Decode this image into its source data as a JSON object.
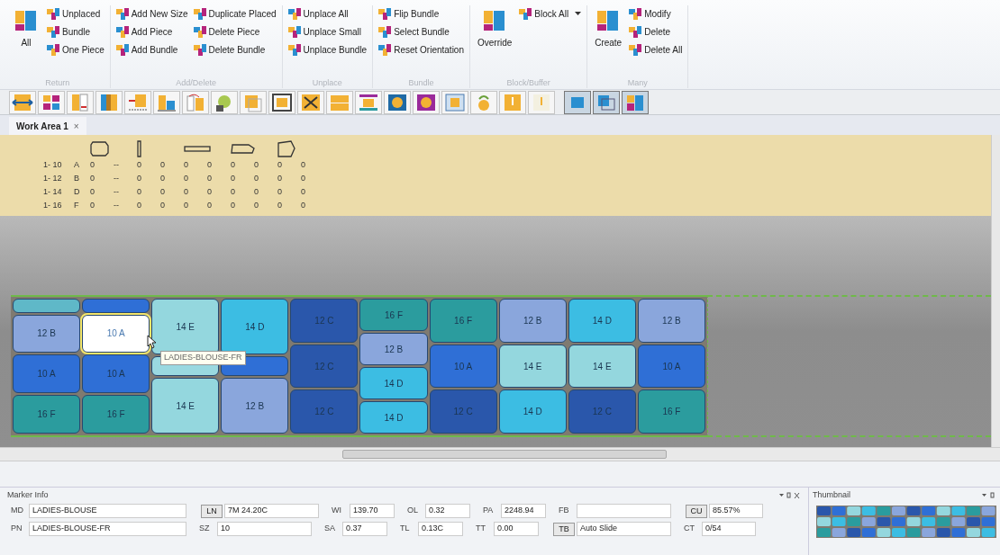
{
  "ribbon": {
    "groups": [
      {
        "title": "Return",
        "large": [
          {
            "label": "All"
          }
        ],
        "small": [
          {
            "label": "Unplaced"
          },
          {
            "label": "Bundle"
          },
          {
            "label": "One Piece"
          }
        ]
      },
      {
        "title": "Add/Delete",
        "small": [
          {
            "label": "Add New Size"
          },
          {
            "label": "Add Piece"
          },
          {
            "label": "Add Bundle"
          },
          {
            "label": "Duplicate Placed"
          },
          {
            "label": "Delete Piece"
          },
          {
            "label": "Delete Bundle"
          }
        ]
      },
      {
        "title": "Unplace",
        "small": [
          {
            "label": "Unplace All"
          },
          {
            "label": "Unplace Small"
          },
          {
            "label": "Unplace Bundle"
          }
        ]
      },
      {
        "title": "Bundle",
        "small": [
          {
            "label": "Flip Bundle"
          },
          {
            "label": "Select Bundle"
          },
          {
            "label": "Reset Orientation"
          }
        ]
      },
      {
        "title": "Block/Buffer",
        "large": [
          {
            "label": "Override"
          }
        ],
        "small": [
          {
            "label": "Block All",
            "dropdown": true
          }
        ]
      },
      {
        "title": "Many",
        "large": [
          {
            "label": "Create"
          }
        ],
        "small": [
          {
            "label": "Modify"
          },
          {
            "label": "Delete"
          },
          {
            "label": "Delete All"
          }
        ]
      }
    ]
  },
  "tab": {
    "label": "Work Area 1",
    "close": "×"
  },
  "piece_table": {
    "rows": [
      {
        "range": "1- 10",
        "code": "A",
        "values": [
          "0",
          "--",
          "0",
          "0",
          "0",
          "0",
          "0",
          "0",
          "0",
          "0"
        ]
      },
      {
        "range": "1- 12",
        "code": "B",
        "values": [
          "0",
          "--",
          "0",
          "0",
          "0",
          "0",
          "0",
          "0",
          "0",
          "0"
        ]
      },
      {
        "range": "1- 14",
        "code": "D",
        "values": [
          "0",
          "--",
          "0",
          "0",
          "0",
          "0",
          "0",
          "0",
          "0",
          "0"
        ]
      },
      {
        "range": "1- 16",
        "code": "F",
        "values": [
          "0",
          "--",
          "0",
          "0",
          "0",
          "0",
          "0",
          "0",
          "0",
          "0"
        ]
      }
    ]
  },
  "marker": {
    "columns": [
      [
        {
          "color": "#5fb8c8"
        },
        {
          "label": "12 B",
          "color": "#8aa6dc"
        },
        {
          "label": "10 A",
          "color": "#2f6fd6"
        },
        {
          "label": "16 F",
          "color": "#2b9c9e"
        }
      ],
      [
        {
          "color": "#2f6fd6"
        },
        {
          "label": "10 A",
          "color": "#ffffff",
          "selected": true
        },
        {
          "label": "10 A",
          "color": "#2f6fd6"
        },
        {
          "label": "16 F",
          "color": "#2b9c9e"
        }
      ],
      [
        {
          "label": "14 E",
          "color": "#94d7de"
        },
        {
          "color": "#9ad9e0"
        },
        {
          "label": "14 E",
          "color": "#94d7de"
        }
      ],
      [
        {
          "label": "14 D",
          "color": "#3cbde3"
        },
        {
          "color": "#2f6fd6"
        },
        {
          "label": "12 B",
          "color": "#8aa6dc"
        }
      ],
      [
        {
          "label": "12 C",
          "color": "#2a57ab"
        },
        {
          "label": "12 C",
          "color": "#2a57ab"
        },
        {
          "label": "12 C",
          "color": "#2a57ab"
        }
      ],
      [
        {
          "label": "16 F",
          "color": "#2b9c9e"
        },
        {
          "label": "12 B",
          "color": "#8aa6dc"
        },
        {
          "label": "14 D",
          "color": "#3cbde3"
        },
        {
          "label": "14 D",
          "color": "#3cbde3"
        }
      ],
      [
        {
          "label": "16 F",
          "color": "#2b9c9e"
        },
        {
          "label": "10 A",
          "color": "#2f6fd6"
        },
        {
          "label": "12 C",
          "color": "#2a57ab"
        }
      ],
      [
        {
          "label": "12 B",
          "color": "#8aa6dc"
        },
        {
          "label": "14 E",
          "color": "#94d7de"
        },
        {
          "label": "14 D",
          "color": "#3cbde3"
        }
      ],
      [
        {
          "label": "14 D",
          "color": "#3cbde3"
        },
        {
          "label": "14 E",
          "color": "#94d7de"
        },
        {
          "label": "12 C",
          "color": "#2a57ab"
        }
      ],
      [
        {
          "label": "12 B",
          "color": "#8aa6dc"
        },
        {
          "label": "10 A",
          "color": "#2f6fd6"
        },
        {
          "label": "16 F",
          "color": "#2b9c9e"
        }
      ]
    ],
    "tooltip": "LADIES-BLOUSE-FR"
  },
  "marker_info": {
    "title": "Marker Info",
    "rows": [
      [
        {
          "label": "MD",
          "value": "LADIES-BLOUSE",
          "button": false
        },
        {
          "label": "LN",
          "button": true,
          "value": "7M 24.20C"
        },
        {
          "label": "WI",
          "value": "139.70",
          "button": false
        },
        {
          "label": "OL",
          "value": "0.32",
          "button": false
        },
        {
          "label": "PA",
          "value": "2248.94",
          "button": false
        },
        {
          "label": "FB",
          "button": false
        },
        {
          "label": "CU",
          "button": true,
          "value": "85.57%"
        }
      ],
      [
        {
          "label": "PN",
          "value": "LADIES-BLOUSE-FR",
          "button": false
        },
        {
          "label": "SZ",
          "value": "10",
          "button": false
        },
        {
          "label": "SA",
          "value": "0.37",
          "button": false
        },
        {
          "label": "TL",
          "value": "0.13C",
          "button": false
        },
        {
          "label": "TT",
          "value": "0.00",
          "button": false
        },
        {
          "label": "TB",
          "button": true,
          "value": "Auto Slide"
        },
        {
          "label": "CT",
          "value": "0/54",
          "button": false
        }
      ]
    ]
  },
  "thumbnail": {
    "title": "Thumbnail"
  }
}
